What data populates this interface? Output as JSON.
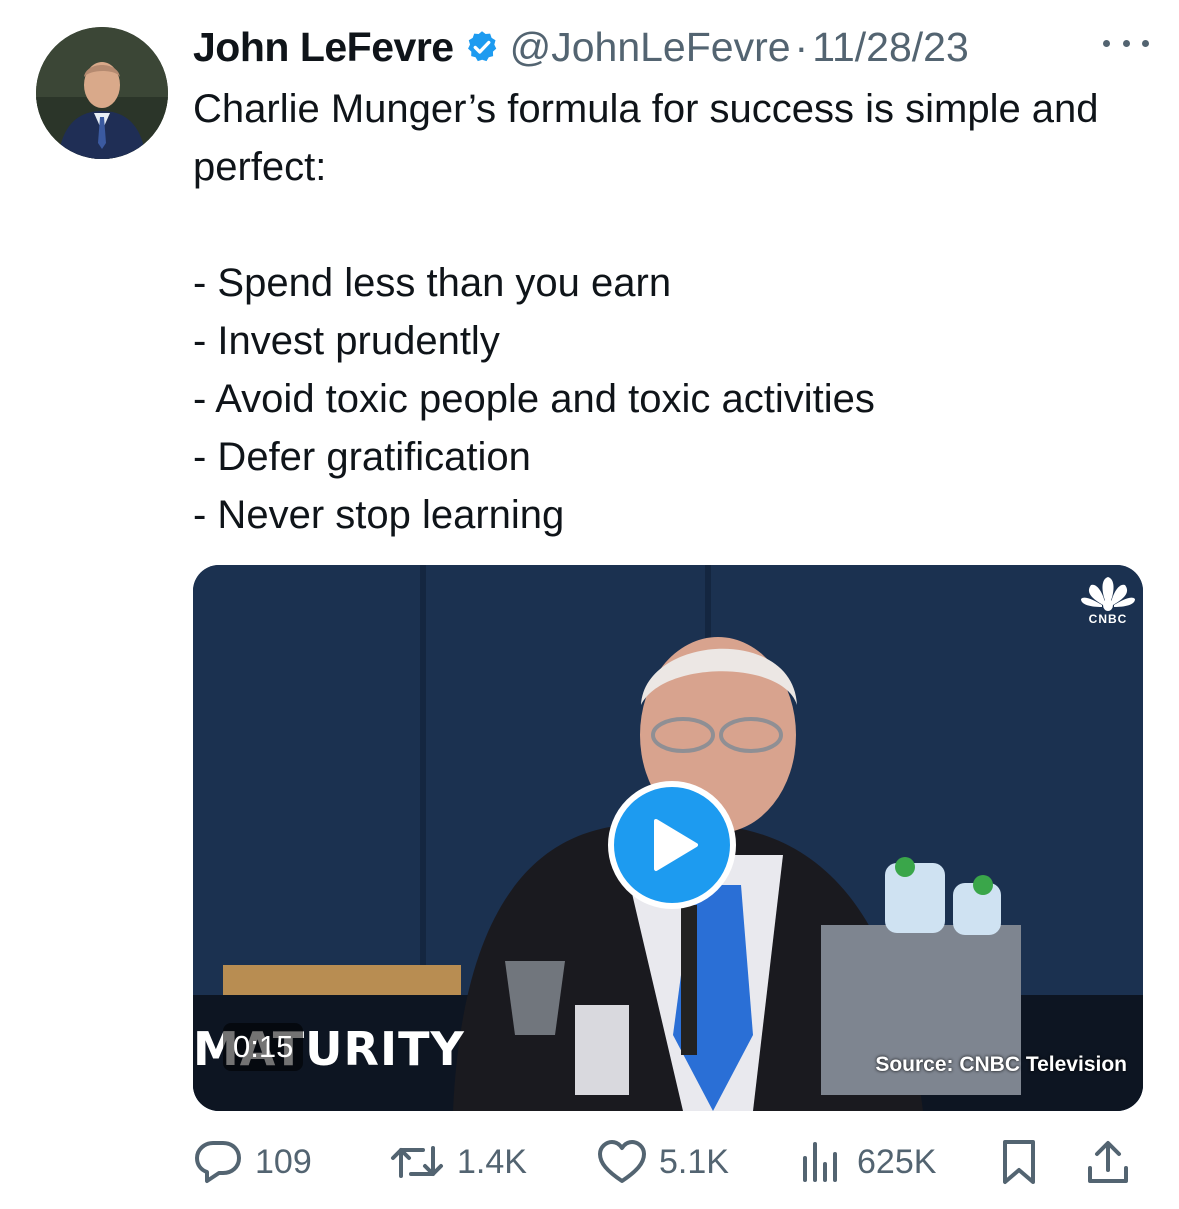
{
  "author": {
    "name": "John LeFevre",
    "handle": "@JohnLeFevre",
    "separator": "·",
    "date": "11/28/23",
    "verified_icon": "verified-badge-icon",
    "avatar_icon": "avatar"
  },
  "tweet": {
    "text": "Charlie Munger’s formula for success is simple and perfect:\n\n- Spend less than you earn\n- Invest prudently\n- Avoid toxic people and toxic activities\n- Defer gratification\n- Never stop learning"
  },
  "media": {
    "duration": "0:15",
    "banner_text": "MATURITY",
    "source_caption": "Source: CNBC Television",
    "network_logo_text": "CNBC",
    "play_icon": "play-icon"
  },
  "actions": {
    "replies": "109",
    "reposts": "1.4K",
    "likes": "5.1K",
    "views": "625K"
  },
  "colors": {
    "accent": "#1d9bf0",
    "secondary_text": "#536471",
    "primary_text": "#0f1419"
  }
}
